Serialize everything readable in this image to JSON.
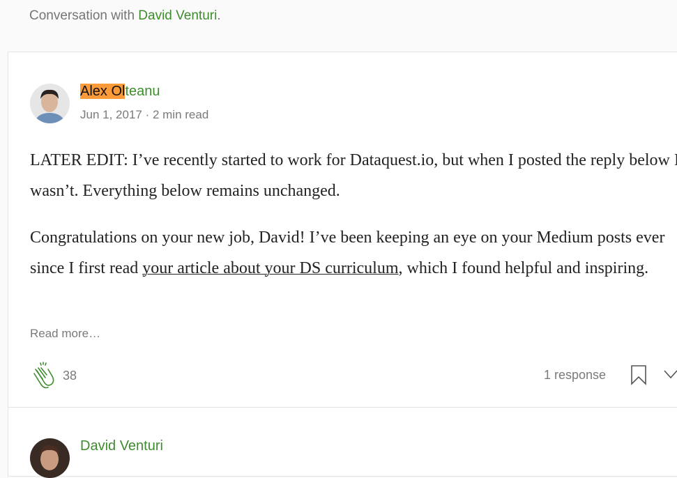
{
  "header": {
    "prefix": "Conversation with ",
    "author": "David Venturi",
    "suffix": "."
  },
  "post": {
    "author_highlight": "Alex Ol",
    "author_rest": "teanu",
    "date": "Jun 1, 2017",
    "read_time": "2 min read",
    "separator": " · ",
    "para1": "LATER EDIT: I’ve recently started to work for Dataquest.io, but when I posted the reply below I wasn’t. Everything below remains unchanged.",
    "para2_before": "Congratulations on your new job, David! I’ve been keeping an eye on your Medium posts ever since I first read ",
    "para2_link": "your article about your DS curriculum",
    "para2_after": ", which I found helpful and inspiring.",
    "read_more": "Read more…",
    "claps": "38",
    "responses": "1 response"
  },
  "reply": {
    "author": "David Venturi"
  },
  "colors": {
    "accent": "#3e8c2e",
    "highlight": "#fb9a38"
  }
}
